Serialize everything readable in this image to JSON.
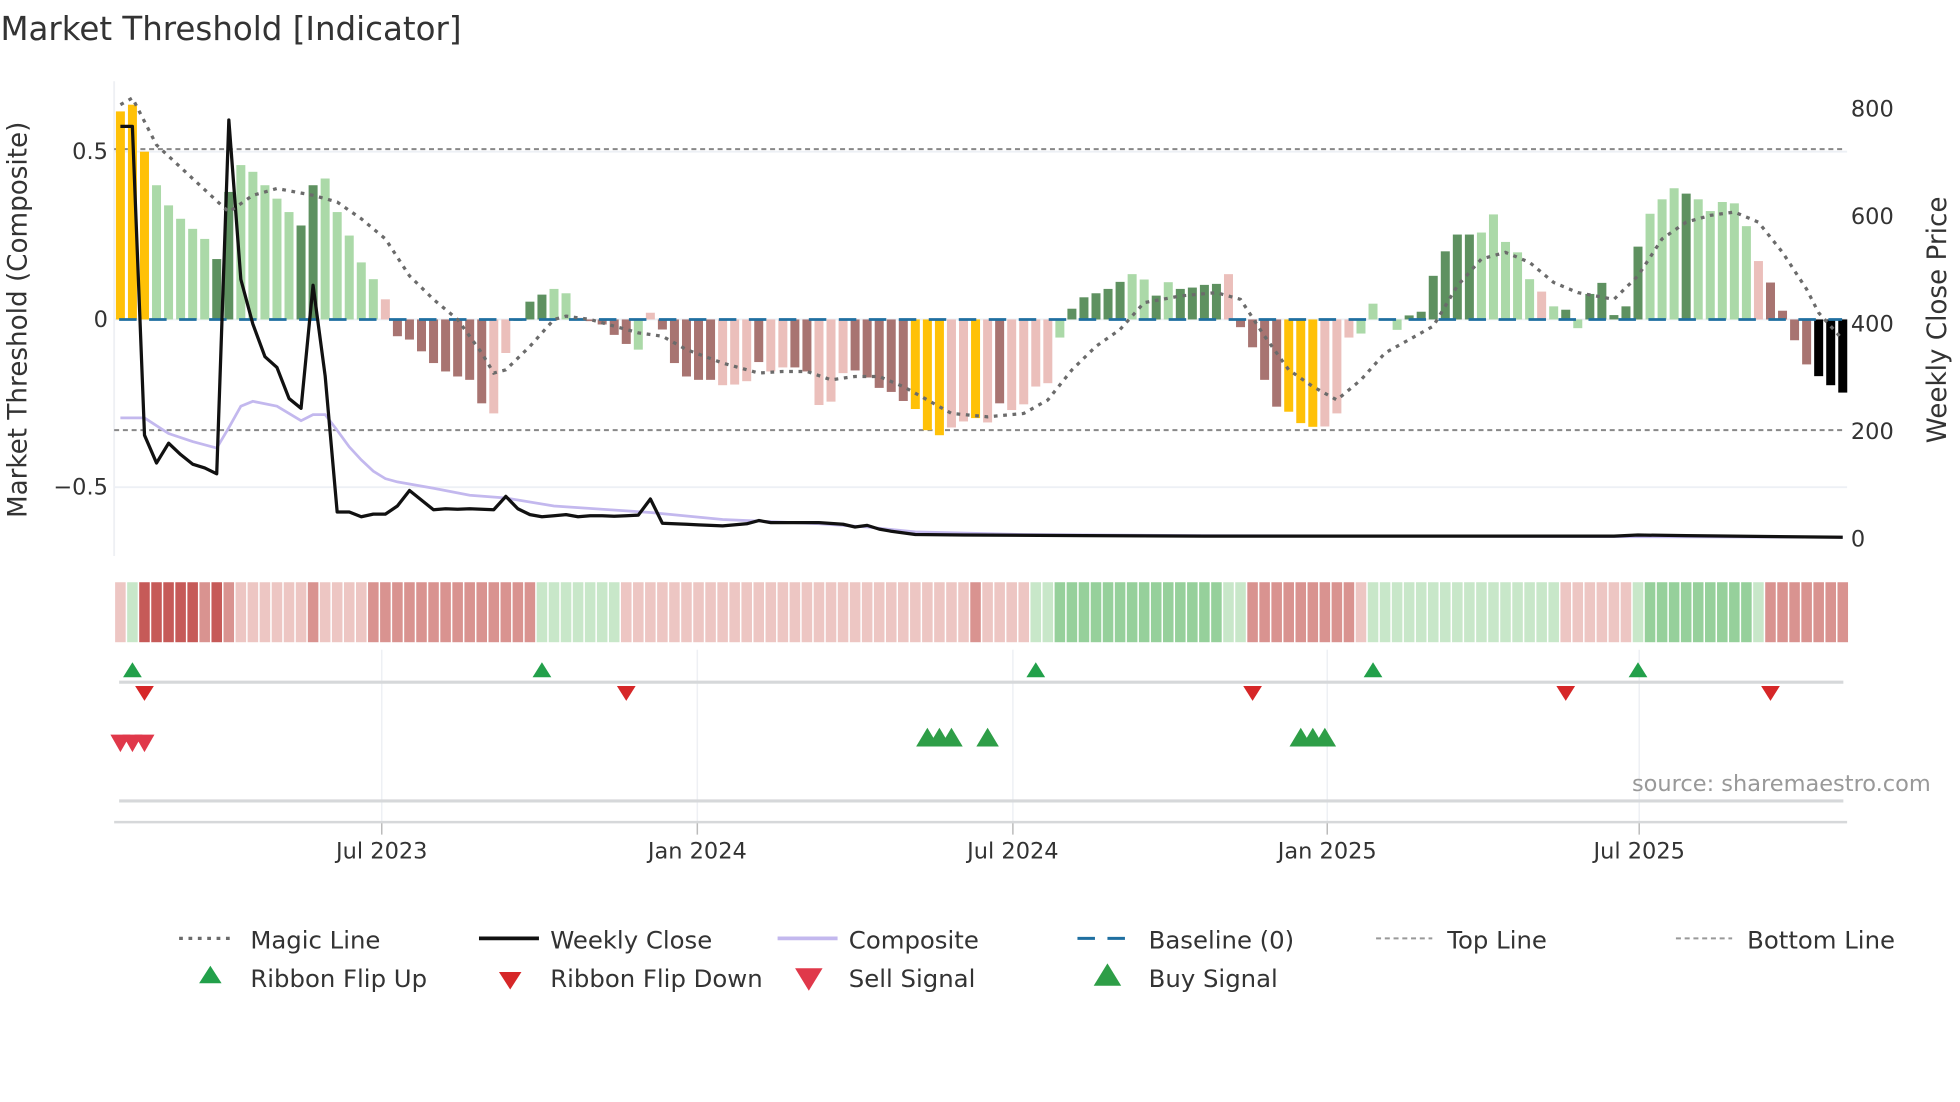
{
  "chart_data": {
    "type": "bar",
    "title": "Market Threshold [Indicator]",
    "ylabel_left": "Market Threshold (Composite)",
    "ylabel_right": "Weekly Close Price",
    "source": "source: sharemaestro.com",
    "left_ticks": [
      {
        "v": 0.5,
        "label": "0.5"
      },
      {
        "v": 0,
        "label": "0"
      },
      {
        "v": -0.5,
        "label": "−0.5"
      }
    ],
    "right_ticks": [
      {
        "v": 800,
        "label": "800"
      },
      {
        "v": 600,
        "label": "600"
      },
      {
        "v": 400,
        "label": "400"
      },
      {
        "v": 200,
        "label": "200"
      },
      {
        "v": 0,
        "label": "0"
      }
    ],
    "x_ticks": [
      {
        "week": 21.7,
        "label": "Jul 2023"
      },
      {
        "week": 47.9,
        "label": "Jan 2024"
      },
      {
        "week": 74.1,
        "label": "Jul 2024"
      },
      {
        "week": 100.2,
        "label": "Jan 2025"
      },
      {
        "week": 126.1,
        "label": "Jul 2025"
      }
    ],
    "ylim_left": [
      -0.705,
      0.71
    ],
    "ylim_right": [
      -32,
      852
    ],
    "top_line": 0.5,
    "bottom_line": -0.33,
    "baseline": 0,
    "colors": {
      "Y": "#FFC107",
      "G": "#5E9160",
      "g": "#ABD9A8",
      "R": "#A87471",
      "r": "#EBBFBB",
      "magic": "#6b6b6b",
      "close": "#111111",
      "composite": "#C3B8EE",
      "baseline": "#1F6FA0",
      "flip_up": "#22A04A",
      "flip_down": "#D62728",
      "sell": "#E0384A",
      "buy": "#2E9E47"
    },
    "bars": {
      "values": [
        0.62,
        0.64,
        0.5,
        0.4,
        0.34,
        0.3,
        0.27,
        0.24,
        0.18,
        0.38,
        0.46,
        0.44,
        0.4,
        0.36,
        0.32,
        0.28,
        0.4,
        0.42,
        0.32,
        0.25,
        0.17,
        0.12,
        0.06,
        -0.05,
        -0.06,
        -0.095,
        -0.13,
        -0.155,
        -0.17,
        -0.18,
        -0.25,
        -0.28,
        -0.1,
        -0.004,
        0.053,
        0.074,
        0.091,
        0.078,
        0.005,
        -0.005,
        -0.015,
        -0.046,
        -0.073,
        -0.09,
        0.02,
        -0.03,
        -0.13,
        -0.17,
        -0.18,
        -0.18,
        -0.196,
        -0.194,
        -0.184,
        -0.127,
        -0.155,
        -0.143,
        -0.143,
        -0.155,
        -0.255,
        -0.245,
        -0.16,
        -0.152,
        -0.173,
        -0.204,
        -0.216,
        -0.243,
        -0.267,
        -0.33,
        -0.345,
        -0.322,
        -0.304,
        -0.294,
        -0.307,
        -0.25,
        -0.27,
        -0.253,
        -0.2,
        -0.19,
        -0.054,
        0.032,
        0.066,
        0.078,
        0.091,
        0.112,
        0.135,
        0.119,
        0.071,
        0.111,
        0.091,
        0.095,
        0.103,
        0.106,
        0.135,
        -0.023,
        -0.083,
        -0.18,
        -0.26,
        -0.275,
        -0.309,
        -0.32,
        -0.319,
        -0.28,
        -0.054,
        -0.042,
        0.047,
        0.003,
        -0.031,
        0.012,
        0.023,
        0.13,
        0.203,
        0.253,
        0.253,
        0.259,
        0.313,
        0.231,
        0.2,
        0.12,
        0.083,
        0.039,
        0.029,
        -0.026,
        0.076,
        0.109,
        0.013,
        0.039,
        0.217,
        0.315,
        0.358,
        0.391,
        0.375,
        0.358,
        0.323,
        0.35,
        0.346,
        0.278,
        0.174,
        0.11,
        0.026,
        -0.062,
        -0.134,
        -0.169,
        -0.196,
        -0.218
      ],
      "states": "YYYgggggGGgggggGGgggggrRRRRRRRRrrGGGggrRRRRgrRRRRRrrrRrrRRrrrRRRRRYYYrrYrRrrrrgGGGGGggGgGGGGrRRRRYYYrrrggrgGGGGGGgggggrgGgGGGGGgggGgggggrRRRR"
    },
    "magic_line": [
      [
        0,
        0.64
      ],
      [
        1,
        0.66
      ],
      [
        3,
        0.52
      ],
      [
        6,
        0.42
      ],
      [
        9,
        0.32
      ],
      [
        11,
        0.37
      ],
      [
        13,
        0.39
      ],
      [
        16,
        0.37
      ],
      [
        18,
        0.35
      ],
      [
        20,
        0.3
      ],
      [
        22,
        0.24
      ],
      [
        24,
        0.13
      ],
      [
        26,
        0.06
      ],
      [
        28,
        0.0
      ],
      [
        30,
        -0.1
      ],
      [
        31,
        -0.16
      ],
      [
        32,
        -0.15
      ],
      [
        34,
        -0.08
      ],
      [
        36,
        0.0
      ],
      [
        37,
        0.01
      ],
      [
        39,
        0.0
      ],
      [
        41,
        -0.02
      ],
      [
        43,
        -0.04
      ],
      [
        45,
        -0.05
      ],
      [
        47,
        -0.09
      ],
      [
        50,
        -0.13
      ],
      [
        53,
        -0.16
      ],
      [
        55,
        -0.155
      ],
      [
        57,
        -0.155
      ],
      [
        59,
        -0.18
      ],
      [
        61,
        -0.17
      ],
      [
        63,
        -0.17
      ],
      [
        65,
        -0.2
      ],
      [
        67,
        -0.24
      ],
      [
        69,
        -0.28
      ],
      [
        72,
        -0.29
      ],
      [
        75,
        -0.28
      ],
      [
        77,
        -0.24
      ],
      [
        79,
        -0.15
      ],
      [
        81,
        -0.08
      ],
      [
        83,
        -0.03
      ],
      [
        85,
        0.05
      ],
      [
        88,
        0.07
      ],
      [
        91,
        0.08
      ],
      [
        93,
        0.06
      ],
      [
        95,
        -0.05
      ],
      [
        97,
        -0.15
      ],
      [
        99,
        -0.2
      ],
      [
        101,
        -0.24
      ],
      [
        103,
        -0.18
      ],
      [
        105,
        -0.1
      ],
      [
        107,
        -0.06
      ],
      [
        109,
        -0.02
      ],
      [
        111,
        0.1
      ],
      [
        113,
        0.18
      ],
      [
        115,
        0.2
      ],
      [
        117,
        0.17
      ],
      [
        119,
        0.11
      ],
      [
        121,
        0.08
      ],
      [
        124,
        0.06
      ],
      [
        126,
        0.13
      ],
      [
        128,
        0.24
      ],
      [
        130,
        0.29
      ],
      [
        132,
        0.31
      ],
      [
        134,
        0.32
      ],
      [
        136,
        0.29
      ],
      [
        138,
        0.2
      ],
      [
        140,
        0.09
      ],
      [
        141,
        0.02
      ],
      [
        143,
        -0.06
      ]
    ],
    "weekly_close": [
      [
        0,
        768
      ],
      [
        1,
        768
      ],
      [
        2,
        193
      ],
      [
        3,
        141
      ],
      [
        4,
        178
      ],
      [
        5,
        157
      ],
      [
        6,
        139
      ],
      [
        7,
        132
      ],
      [
        8,
        121
      ],
      [
        9,
        780
      ],
      [
        10,
        483
      ],
      [
        11,
        400
      ],
      [
        12,
        339
      ],
      [
        13,
        319
      ],
      [
        14,
        261
      ],
      [
        15,
        243
      ],
      [
        16,
        472
      ],
      [
        17,
        303
      ],
      [
        18,
        50
      ],
      [
        19,
        50
      ],
      [
        20,
        41
      ],
      [
        21,
        46
      ],
      [
        22,
        46
      ],
      [
        23,
        61
      ],
      [
        24,
        90
      ],
      [
        25,
        72
      ],
      [
        26,
        54
      ],
      [
        27,
        56
      ],
      [
        28,
        55
      ],
      [
        29,
        56
      ],
      [
        30,
        55
      ],
      [
        31,
        54
      ],
      [
        32,
        79
      ],
      [
        33,
        56
      ],
      [
        34,
        45
      ],
      [
        35,
        41
      ],
      [
        36,
        43
      ],
      [
        37,
        45
      ],
      [
        38,
        41
      ],
      [
        39,
        43
      ],
      [
        40,
        43
      ],
      [
        41,
        42
      ],
      [
        42,
        43
      ],
      [
        43,
        44
      ],
      [
        44,
        74
      ],
      [
        45,
        29
      ],
      [
        46,
        28
      ],
      [
        47,
        27
      ],
      [
        48,
        26
      ],
      [
        49,
        25
      ],
      [
        50,
        24
      ],
      [
        52,
        28
      ],
      [
        53,
        34
      ],
      [
        54,
        30
      ],
      [
        58,
        30
      ],
      [
        60,
        27
      ],
      [
        61,
        22
      ],
      [
        62,
        25
      ],
      [
        63,
        18
      ],
      [
        64,
        14
      ],
      [
        66,
        8
      ],
      [
        70,
        7
      ],
      [
        80,
        6
      ],
      [
        90,
        5
      ],
      [
        100,
        5
      ],
      [
        110,
        5
      ],
      [
        124,
        5
      ],
      [
        126,
        7
      ],
      [
        130,
        6
      ],
      [
        143,
        3
      ]
    ],
    "composite": [
      [
        0,
        225
      ],
      [
        2,
        225
      ],
      [
        4,
        196
      ],
      [
        6,
        181
      ],
      [
        8,
        169
      ],
      [
        9,
        207
      ],
      [
        10,
        247
      ],
      [
        11,
        256
      ],
      [
        13,
        247
      ],
      [
        15,
        220
      ],
      [
        16,
        231
      ],
      [
        17,
        231
      ],
      [
        18,
        202
      ],
      [
        19,
        171
      ],
      [
        20,
        147
      ],
      [
        21,
        126
      ],
      [
        22,
        112
      ],
      [
        23,
        106
      ],
      [
        26,
        94
      ],
      [
        29,
        81
      ],
      [
        32,
        76
      ],
      [
        36,
        61
      ],
      [
        44,
        49
      ],
      [
        50,
        36
      ],
      [
        58,
        28
      ],
      [
        62,
        22
      ],
      [
        66,
        13
      ],
      [
        75,
        8
      ],
      [
        90,
        6
      ],
      [
        110,
        5
      ],
      [
        143,
        3
      ]
    ],
    "ribbon": [
      -1,
      1,
      -3,
      -3,
      -3,
      -3,
      -3,
      -2,
      -3,
      -2,
      -1,
      -1,
      -1,
      -1,
      -1,
      -1,
      -2,
      -1,
      -1,
      -1,
      -1,
      -2,
      -2,
      -2,
      -2,
      -2,
      -2,
      -2,
      -2,
      -2,
      -2,
      -2,
      -2,
      -2,
      -2,
      1,
      1,
      1,
      1,
      1,
      1,
      1,
      -1,
      -1,
      -1,
      -1,
      -1,
      -1,
      -1,
      -1,
      -1,
      -1,
      -1,
      -1,
      -1,
      -1,
      -1,
      -1,
      -1,
      -1,
      -1,
      -1,
      -1,
      -1,
      -1,
      -1,
      -1,
      -1,
      -1,
      -1,
      -1,
      -2,
      -1,
      -1,
      -1,
      -1,
      1,
      1,
      2,
      2,
      2,
      2,
      2,
      2,
      2,
      2,
      2,
      2,
      2,
      2,
      2,
      2,
      1,
      1,
      -2,
      -2,
      -2,
      -2,
      -2,
      -2,
      -2,
      -2,
      -2,
      -1,
      1,
      1,
      1,
      1,
      1,
      1,
      1,
      1,
      1,
      1,
      1,
      1,
      1,
      1,
      1,
      1,
      -1,
      -1,
      -1,
      -1,
      -1,
      -1,
      1,
      2,
      2,
      2,
      2,
      2,
      2,
      2,
      2,
      2,
      1,
      -2,
      -2,
      -2,
      -2,
      -2,
      -2,
      -2
    ],
    "ribbon_flip_up": [
      1,
      35,
      76,
      104,
      126
    ],
    "ribbon_flip_down": [
      2,
      42,
      94,
      120,
      137
    ],
    "sell_signal": [
      0,
      1,
      2
    ],
    "buy_signal": [
      67,
      68,
      69,
      72,
      98,
      99,
      100
    ],
    "legend": [
      {
        "key": "magic",
        "label": "Magic Line"
      },
      {
        "key": "close",
        "label": "Weekly Close"
      },
      {
        "key": "composite",
        "label": "Composite"
      },
      {
        "key": "baseline",
        "label": "Baseline (0)"
      },
      {
        "key": "top",
        "label": "Top Line"
      },
      {
        "key": "bottom",
        "label": "Bottom Line"
      },
      {
        "key": "flip_up",
        "label": "Ribbon Flip Up"
      },
      {
        "key": "flip_down",
        "label": "Ribbon Flip Down"
      },
      {
        "key": "sell",
        "label": "Sell Signal"
      },
      {
        "key": "buy",
        "label": "Buy Signal"
      }
    ]
  }
}
